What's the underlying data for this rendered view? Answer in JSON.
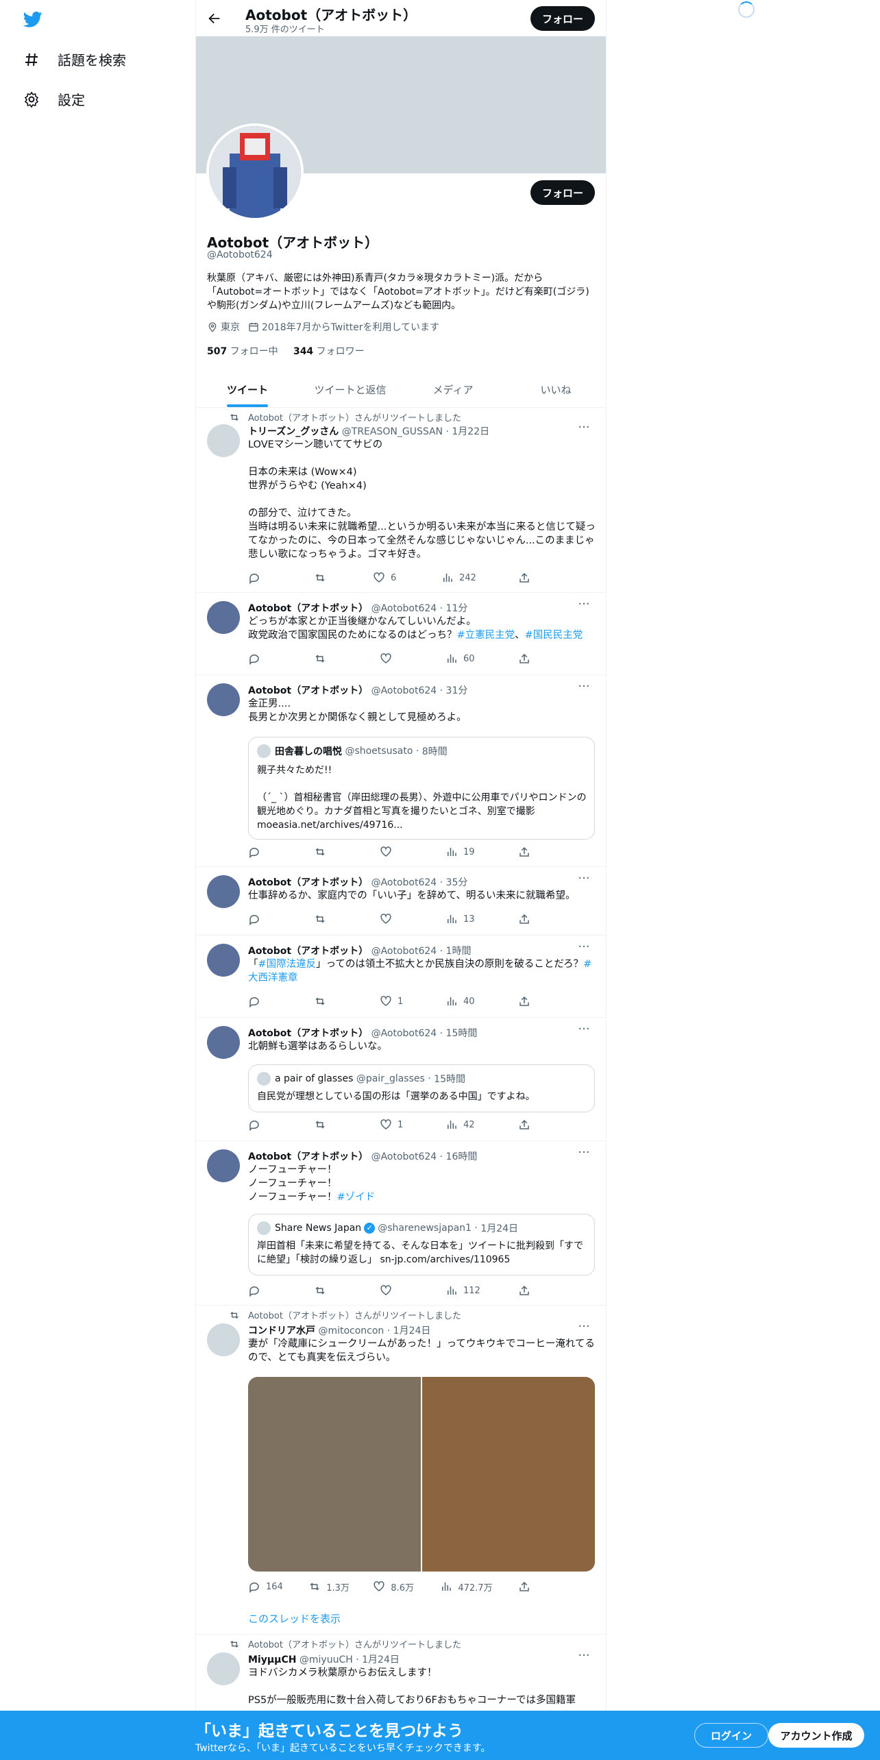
{
  "nav": {
    "items": [
      {
        "label": "話題を検索",
        "icon": "hashtag-icon"
      },
      {
        "label": "設定",
        "icon": "gear-icon"
      }
    ]
  },
  "header": {
    "title": "Aotobot（アオトボット）",
    "subtitle": "5.9万 件のツイート",
    "follow_label": "フォロー"
  },
  "profile": {
    "name": "Aotobot（アオトボット）",
    "handle": "@Aotobot624",
    "bio": "秋葉原（アキバ、厳密には外神田)系青戸(タカラ※現タカラトミー)派。だから「Autobot=オートボット」ではなく「Aotobot=アオトボット」。だけど有楽町(ゴジラ)や駒形(ガンダム)や立川(フレームアームズ)なども範囲内。",
    "location": "東京",
    "joined": "2018年7月からTwitterを利用しています",
    "following_count": "507",
    "following_label": "フォロー中",
    "followers_count": "344",
    "followers_label": "フォロワー",
    "follow_label": "フォロー"
  },
  "tabs": [
    "ツイート",
    "ツイートと返信",
    "メディア",
    "いいね"
  ],
  "tweets": [
    {
      "retweet_label": "Aotobot（アオトボット）さんがリツイートしました",
      "name": "トリーズン_グッさん",
      "handle": "@TREASON_GUSSAN",
      "time": "1月22日",
      "text": "LOVEマシーン聴いててサビの\n\n日本の未来は (Wow×4)\n世界がうらやむ (Yeah×4)\n\nの部分で、泣けてきた。\n当時は明るい未来に就職希望...というか明るい未来が本当に来ると信じて疑ってなかったのに、今の日本って全然そんな感じじゃないじゃん...このままじゃ悲しい歌になっちゃうよ。ゴマキ好き。",
      "replies": "",
      "retweets": "",
      "likes": "6",
      "views": "242"
    },
    {
      "name": "Aotobot（アオトボット）",
      "handle": "@Aotobot624",
      "time": "11分",
      "text": "どっちが本家とか正当後継かなんてしいいんだよ。\n政党政治で国家国民のためになるのはどっち？",
      "hashtag1": "#立憲民主党",
      "sep": "、",
      "hashtag2": "#国民民主党",
      "replies": "",
      "retweets": "",
      "likes": "",
      "views": "60"
    },
    {
      "name": "Aotobot（アオトボット）",
      "handle": "@Aotobot624",
      "time": "31分",
      "text": "金正男....\n長男とか次男とか関係なく親として見極めろよ。",
      "quote": {
        "name": "田舎暮しの唱悦",
        "handle": "@shoetsusato",
        "time": "8時間",
        "text": "親子共々ためだ!!\n\n（´_ `）首相秘書官（岸田総理の長男）、外遊中に公用車でパリやロンドンの観光地めぐり。カナダ首相と写真を撮りたいとゴネ、別室で撮影 moeasia.net/archives/49716..."
      },
      "replies": "",
      "retweets": "",
      "likes": "",
      "views": "19"
    },
    {
      "name": "Aotobot（アオトボット）",
      "handle": "@Aotobot624",
      "time": "35分",
      "text": "仕事辞めるか、家庭内での「いい子」を辞めて、明るい未来に就職希望。",
      "replies": "",
      "retweets": "",
      "likes": "",
      "views": "13"
    },
    {
      "name": "Aotobot（アオトボット）",
      "handle": "@Aotobot624",
      "time": "1時間",
      "text_pre": "「",
      "hashtag1": "#国際法違反",
      "text_mid": "」ってのは領土不拡大とか民族自決の原則を破ることだろ？",
      "hashtag2": "#大西洋憲章",
      "replies": "",
      "retweets": "",
      "likes": "1",
      "views": "40"
    },
    {
      "name": "Aotobot（アオトボット）",
      "handle": "@Aotobot624",
      "time": "15時間",
      "text": "北朝鮮も選挙はあるらしいな。",
      "quote": {
        "name": "a pair of glasses",
        "handle": "@pair_glasses",
        "time": "15時間",
        "text": "自民党が理想としている国の形は「選挙のある中国」ですよね。"
      },
      "replies": "",
      "retweets": "",
      "likes": "1",
      "views": "42"
    },
    {
      "name": "Aotobot（アオトボット）",
      "handle": "@Aotobot624",
      "time": "16時間",
      "text": "ノーフューチャー！\nノーフューチャー！\nノーフューチャー！",
      "hashtag1": "#ゾイド",
      "quote": {
        "name": "Share News Japan",
        "handle": "@sharenewsjapan1",
        "time": "1月24日",
        "text": "岸田首相「未来に希望を持てる、そんな日本を」ツイートに批判殺到「すでに絶望」「検討の繰り返し」 sn-jp.com/archives/110965"
      },
      "replies": "",
      "retweets": "",
      "likes": "",
      "views": "112"
    },
    {
      "retweet_label": "Aotobot（アオトボット）さんがリツイートしました",
      "name": "コンドリア水戸",
      "handle": "@mitoconcon",
      "time": "1月24日",
      "text": "妻が「冷蔵庫にシュークリームがあった！」ってウキウキでコーヒー淹れてるので、とても真実を伝えづらい。",
      "replies": "164",
      "retweets": "1.3万",
      "likes": "8.6万",
      "views": "472.7万",
      "show_thread": "このスレッドを表示",
      "media_colors": [
        "#7f7160",
        "#8b6440"
      ]
    },
    {
      "retweet_label": "Aotobot（アオトボット）さんがリツイートしました",
      "name": "MiyμμCH",
      "handle": "@miyuuCH",
      "time": "1月24日",
      "text": "ヨドバシカメラ秋葉原からお伝えします！\n\nPS5が一般販売用に数十台入荷しており6Fおもちゃコーナーでは多国籍軍"
    }
  ],
  "bottom_bar": {
    "title": "「いま」起きていることを見つけよう",
    "subtitle": "Twitterなら、「いま」起きていることをいち早くチェックできます。",
    "login": "ログイン",
    "signup": "アカウント作成"
  },
  "colors": {
    "accent": "#1d9bf0",
    "text": "#0f1419",
    "muted": "#536471",
    "banner": "#cfd9de"
  }
}
